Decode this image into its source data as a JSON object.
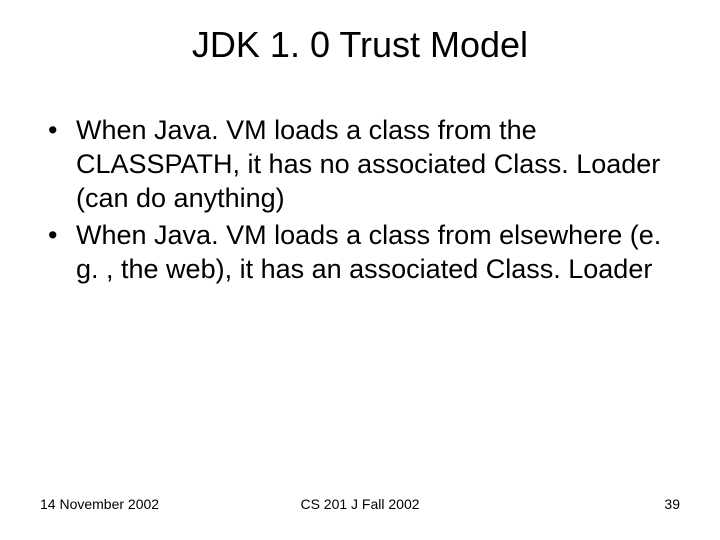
{
  "title": "JDK 1. 0 Trust Model",
  "bullets": [
    "When Java. VM loads a class from the CLASSPATH, it has no associated Class. Loader (can do anything)",
    "When Java. VM loads a class from elsewhere (e. g. , the web), it has an associated Class. Loader"
  ],
  "footer": {
    "date": "14 November 2002",
    "course": "CS 201 J Fall 2002",
    "page": "39"
  }
}
